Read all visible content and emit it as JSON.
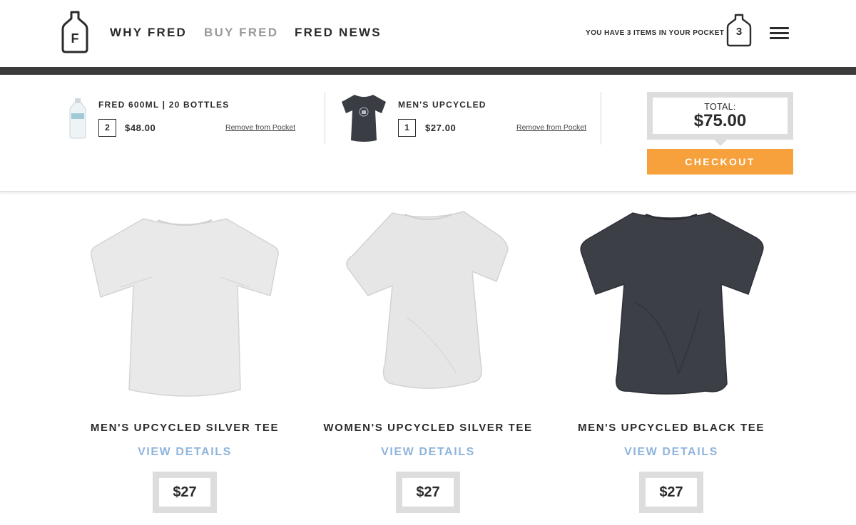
{
  "header": {
    "nav": [
      {
        "label": "WHY FRED"
      },
      {
        "label": "BUY FRED"
      },
      {
        "label": "FRED NEWS"
      }
    ],
    "pocket_text": "YOU HAVE 3 ITEMS IN YOUR POCKET",
    "pocket_count": "3",
    "logo_letter": "F"
  },
  "cart": {
    "items": [
      {
        "name": "FRED 600ML | 20 BOTTLES",
        "qty": "2",
        "price": "$48.00",
        "remove_label": "Remove from Pocket"
      },
      {
        "name": "MEN'S UPCYCLED",
        "qty": "1",
        "price": "$27.00",
        "remove_label": "Remove from Pocket"
      }
    ],
    "total_label": "TOTAL:",
    "total_value": "$75.00",
    "checkout_label": "CHECKOUT"
  },
  "products": [
    {
      "title": "MEN'S UPCYCLED SILVER TEE",
      "details_label": "VIEW DETAILS",
      "price": "$27",
      "color": "#e9e9e9"
    },
    {
      "title": "WOMEN'S UPCYCLED SILVER TEE",
      "details_label": "VIEW DETAILS",
      "price": "$27",
      "color": "#e6e6e6"
    },
    {
      "title": "MEN'S UPCYCLED BLACK TEE",
      "details_label": "VIEW DETAILS",
      "price": "$27",
      "color": "#3d3f47"
    }
  ],
  "colors": {
    "accent": "#f7a13c",
    "link": "#8fb4dc",
    "dark_bar": "#3b3b3b",
    "text": "#2b2b2b"
  }
}
